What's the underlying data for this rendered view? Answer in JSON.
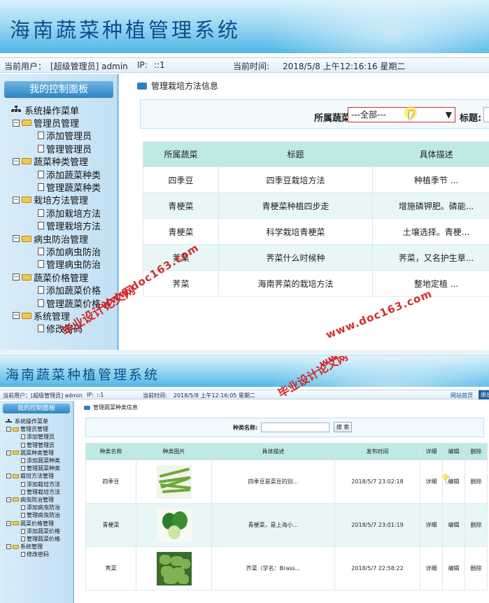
{
  "app": {
    "title": "海南蔬菜种植管理系统"
  },
  "infobar": {
    "user_label": "当前用户：",
    "user_value": "[超级管理员] admin",
    "ip_label": "IP:",
    "ip_value": "::1",
    "time_label": "当前时间:",
    "time_value_1": "2018/5/8 上午12:16:16 星期二",
    "time_value_2": "2018/5/8 上午12:16:05 星期二",
    "home_link": "网站首页",
    "exit_link": "退出"
  },
  "sidebar": {
    "head": "我的控制面板",
    "root": "系统操作菜单",
    "groups": [
      {
        "label": "管理员管理",
        "items": [
          "添加管理员",
          "管理管理员"
        ]
      },
      {
        "label": "蔬菜种类管理",
        "items": [
          "添加蔬菜种类",
          "管理蔬菜种类"
        ]
      },
      {
        "label": "栽培方法管理",
        "items": [
          "添加栽培方法",
          "管理栽培方法"
        ]
      },
      {
        "label": "病虫防治管理",
        "items": [
          "添加病虫防治",
          "管理病虫防治"
        ]
      },
      {
        "label": "蔬菜价格管理",
        "items": [
          "添加蔬菜价格",
          "管理蔬菜价格"
        ]
      },
      {
        "label": "系统管理",
        "items": [
          "修改密码"
        ]
      }
    ]
  },
  "screen1": {
    "crumb": "管理栽培方法信息",
    "filter": {
      "veg_label": "所属蔬菜",
      "veg_selected": "---全部---",
      "title_label": "标题:"
    },
    "columns": [
      "所属蔬菜",
      "标题",
      "具体描述"
    ],
    "rows": [
      [
        "四季豆",
        "四季豆栽培方法",
        "种植季节 ..."
      ],
      [
        "青梗菜",
        "青梗菜种植四步走",
        "增施磷钾肥。磷能..."
      ],
      [
        "青梗菜",
        "科学栽培青梗菜",
        "土壤选择。青梗..."
      ],
      [
        "荠菜",
        "荠菜什么时候种",
        "荠菜，又名护生草..."
      ],
      [
        "荠菜",
        "海南荠菜的栽培方法",
        "整地定植 ..."
      ]
    ]
  },
  "screen2": {
    "crumb": "管理蔬菜种类信息",
    "filter": {
      "name_label": "种类名称:",
      "name_value": "",
      "search_button": "搜 索"
    },
    "columns": [
      "种类名称",
      "种类图片",
      "具体描述",
      "发布时间",
      "详细",
      "编辑",
      "删除"
    ],
    "rows": [
      {
        "name": "四季豆",
        "image": "green-beans-image",
        "desc": "四季豆是菜豆的别...",
        "time": "2018/5/7 23:02:18",
        "detail": "详细",
        "edit": "编辑",
        "delete": "删除"
      },
      {
        "name": "青梗菜",
        "image": "bok-choy-image",
        "desc": "青梗菜，是上海小...",
        "time": "2018/5/7 23:01:19",
        "detail": "详细",
        "edit": "编辑",
        "delete": "删除"
      },
      {
        "name": "荠菜",
        "image": "shepherds-purse-image",
        "desc": "芥菜（学名：Brass...",
        "time": "2018/5/7 22:58:22",
        "detail": "详细",
        "edit": "编辑",
        "delete": "删除"
      }
    ]
  },
  "watermarks": {
    "cn": "毕业设计论文网",
    "url": "www.doc163.com"
  },
  "colors": {
    "banner": "#4fb6e6",
    "title_text": "#0b4f8a",
    "table_header": "#bfe9e4",
    "row_alt": "#e8f7f5",
    "watermark": "#d21a1a",
    "sidebar_head": "#2f84c4"
  }
}
